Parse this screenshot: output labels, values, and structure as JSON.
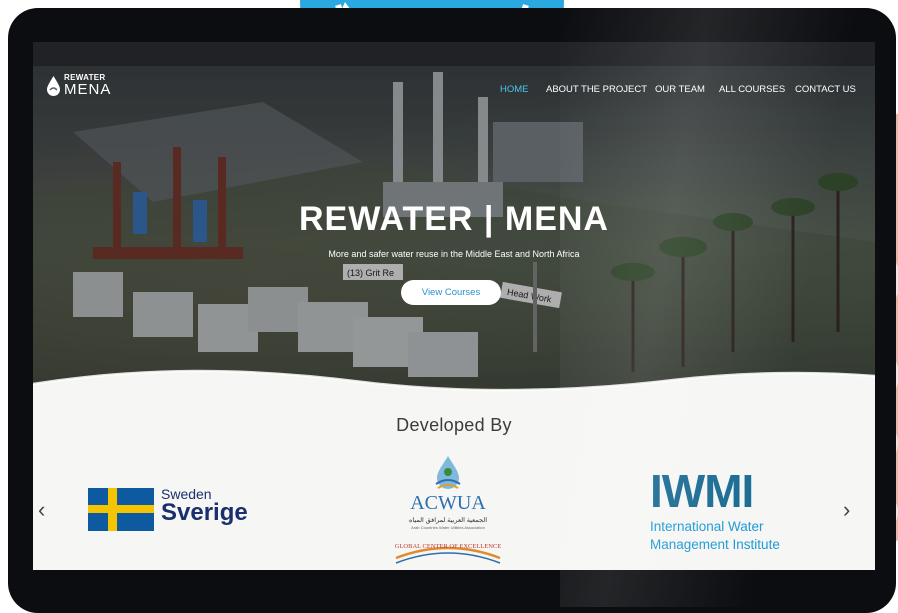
{
  "site": {
    "logo": {
      "line1": "REWATER",
      "line2": "MENA",
      "icon": "water-drop-icon"
    },
    "nav": [
      {
        "label": "HOME",
        "active": true
      },
      {
        "label": "ABOUT THE PROJECT",
        "active": false
      },
      {
        "label": "OUR TEAM",
        "active": false
      },
      {
        "label": "ALL COURSES",
        "active": false
      },
      {
        "label": "CONTACT US",
        "active": false
      }
    ],
    "hero": {
      "title": "REWATER | MENA",
      "subtitle": "More and safer water reuse in the Middle East and North Africa",
      "cta_label": "View Courses",
      "model_signs": [
        "(13) Grit Re",
        "Head Work"
      ]
    },
    "developed_by": {
      "heading": "Developed By",
      "prev_icon": "chevron-left-icon",
      "next_icon": "chevron-right-icon",
      "partners": [
        {
          "line1": "Sweden",
          "line2": "Sverige"
        },
        {
          "name": "ACWUA",
          "arabic": "الجمعية العربية لمرافق المياه",
          "subtitle": "Arab Countries Water Utilities Association",
          "tagline": "GLOBAL CENTER OF EXCELLENCE"
        },
        {
          "name": "IWMI",
          "line1": "International Water",
          "line2": "Management Institute"
        }
      ]
    }
  },
  "colors": {
    "accent": "#4cc3ee",
    "cta_text": "#2b8fd1",
    "sweden_blue": "#0d5aa0",
    "sweden_yellow": "#f5c400",
    "iwmi_dark": "#1a6b93",
    "iwmi_light": "#1d9ad6",
    "device_frame": "#0c0d10"
  }
}
